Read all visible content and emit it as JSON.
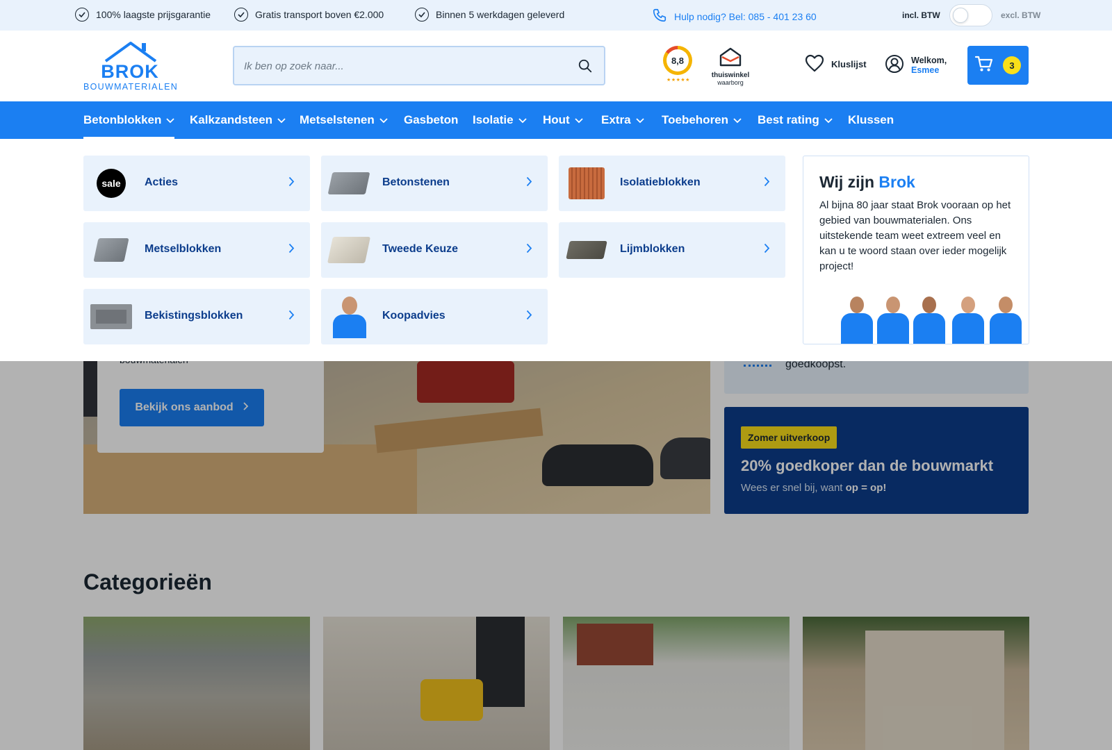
{
  "topbar": {
    "usps": [
      "100% laagste prijsgarantie",
      "Gratis transport boven €2.000",
      "Binnen 5 werkdagen geleverd"
    ],
    "help": "Hulp nodig? Bel: 085 - 401 23 60",
    "vat_incl": "incl. BTW",
    "vat_excl": "excl. BTW"
  },
  "header": {
    "logo_main": "BROK",
    "logo_sub": "BOUWMATERIALEN",
    "search_placeholder": "Ik ben op zoek naar...",
    "rating": "8,8",
    "rating_stars": "★★★★★",
    "tw_line1": "thuiswinkel",
    "tw_line2": "waarborg",
    "wishlist": "Kluslijst",
    "welcome": "Welkom,",
    "user": "Esmee",
    "cart_count": "3"
  },
  "nav": [
    {
      "label": "Betonblokken",
      "dropdown": true,
      "active": true
    },
    {
      "label": "Kalkzandsteen",
      "dropdown": true
    },
    {
      "label": "Metselstenen",
      "dropdown": true
    },
    {
      "label": "Gasbeton",
      "dropdown": false
    },
    {
      "label": "Isolatie",
      "dropdown": true
    },
    {
      "label": "Hout",
      "dropdown": true
    },
    {
      "label": "Extra",
      "dropdown": true
    },
    {
      "label": "Toebehoren",
      "dropdown": true
    },
    {
      "label": "Best rating",
      "dropdown": true
    },
    {
      "label": "Klussen",
      "dropdown": false
    }
  ],
  "dropdown": {
    "tiles": [
      {
        "label": "Acties",
        "thumb": "sale-badge",
        "sale_text": "sale"
      },
      {
        "label": "Betonstenen",
        "thumb": "concrete-brick"
      },
      {
        "label": "Isolatieblokken",
        "thumb": "insulation-block"
      },
      {
        "label": "Metselblokken",
        "thumb": "masonry-block"
      },
      {
        "label": "Tweede Keuze",
        "thumb": "second-choice-block"
      },
      {
        "label": "Lijmblokken",
        "thumb": "glue-block"
      },
      {
        "label": "Bekistingsblokken",
        "thumb": "formwork-block"
      },
      {
        "label": "Koopadvies",
        "thumb": "advisor-person"
      }
    ],
    "about": {
      "title_pre": "Wij zijn",
      "title_brand": "Brok",
      "text": "Al bijna 80 jaar staat Brok vooraan op het gebied van bouwmaterialen. Ons uitstekende team weet extreem veel en kan u te woord staan over ieder mogelijk project!"
    }
  },
  "page": {
    "hero_tail": "bouwmaterialen",
    "hero_button": "Bekijk ons aanbod",
    "usp_tail": "goedkoopst.",
    "promo_tag": "Zomer uitverkoop",
    "promo_title": "20% goedkoper dan de bouwmarkt",
    "promo_sub_pre": "Wees er snel bij, want",
    "promo_sub_bold": "op = op!",
    "categories_title": "Categorieën"
  },
  "colors": {
    "primary": "#1b7ff2",
    "navy": "#0c3d8c",
    "light": "#e9f2fc",
    "yellow": "#f9df1a"
  }
}
